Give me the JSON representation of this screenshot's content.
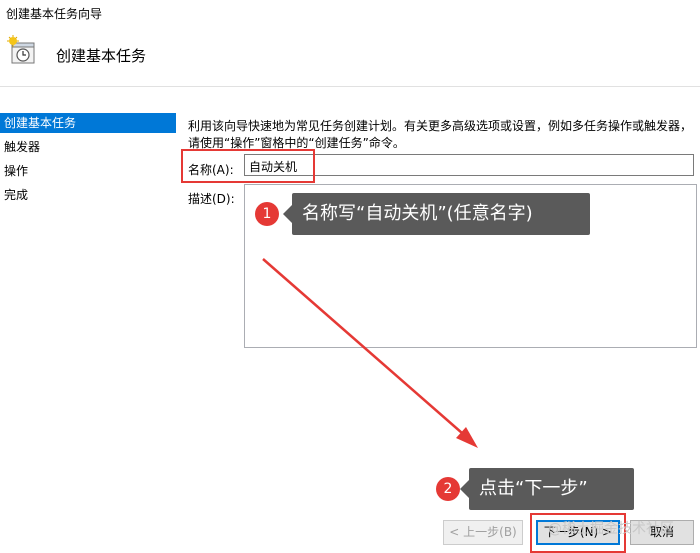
{
  "window": {
    "title": "创建基本任务向导"
  },
  "header": {
    "title": "创建基本任务",
    "icon": "clock-icon"
  },
  "sidebar": {
    "items": [
      {
        "label": "创建基本任务",
        "selected": true
      },
      {
        "label": "触发器"
      },
      {
        "label": "操作"
      },
      {
        "label": "完成"
      }
    ]
  },
  "main": {
    "description": "利用该向导快速地为常见任务创建计划。有关更多高级选项或设置，例如多任务操作或触发器，请使用“操作”窗格中的“创建任务”命令。",
    "name_label": "名称(A):",
    "name_value": "自动关机",
    "desc_label": "描述(D):",
    "desc_value": ""
  },
  "annotations": [
    {
      "number": "1",
      "text": "名称写“自动关机”(任意名字)"
    },
    {
      "number": "2",
      "text": "点击“下一步”"
    }
  ],
  "buttons": {
    "back": "< 上一步(B)",
    "next": "下一步(N) >",
    "cancel": "取消"
  },
  "watermark": "@稀土掘金技术社区",
  "colors": {
    "accent": "#0078d7",
    "annotation_red": "#e53935",
    "callout_bg": "#5a5a5a"
  }
}
